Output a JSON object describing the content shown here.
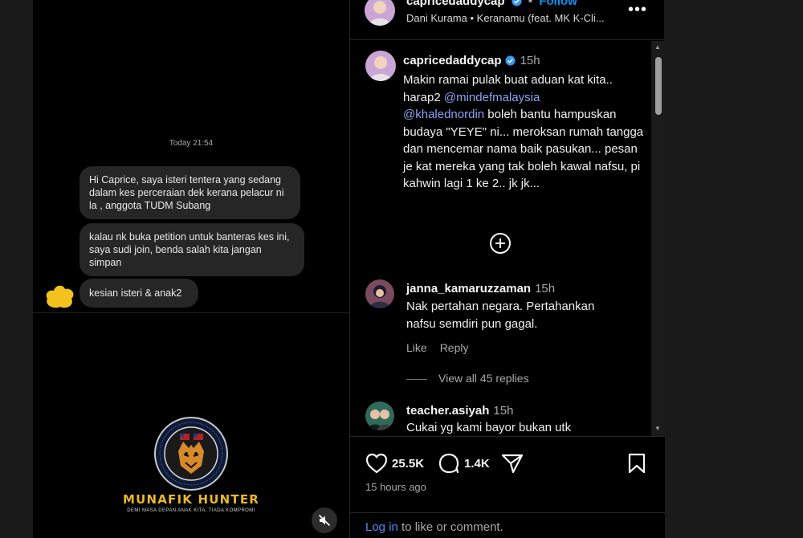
{
  "dm": {
    "timestamp": "Today 21:54",
    "messages": [
      "Hi Caprice, saya isteri tentera yang sedang dalam kes perceraian dek kerana pelacur ni la , anggota TUDM Subang",
      "kalau nk buka petition untuk banteras kes ini, saya sudi join, benda salah kita jangan simpan",
      "kesian isteri & anak2"
    ]
  },
  "brand": {
    "title": "MUNAFIK HUNTER",
    "tagline": "DEMI MASA DEPAN ANAK KITA, TIADA KOMPROMI",
    "accent_color": "#e9b82a"
  },
  "post": {
    "username": "capricedaddycap",
    "follow_label": "Follow",
    "music": "Dani Kurama • Keranamu (feat. MK K-Cli...",
    "more_icon": "more-horizontal-icon",
    "caption": {
      "username": "capricedaddycap",
      "time": "15h",
      "text_before": "Makin ramai pulak buat aduan kat kita.. harap2 ",
      "mention1": "@mindefmalaysia",
      "mention2": "@khalednordin",
      "text_after": " boleh bantu hampuskan budaya \"YEYE\" ni... meroksan rumah tangga dan mencemar nama baik pasukan... pesan je kat mereka yang tak boleh kawal nafsu, pi kahwin lagi 1 ke 2.. jk jk..."
    },
    "comments": [
      {
        "username": "janna_kamaruzzaman",
        "time": "15h",
        "text": "Nak pertahan negara. Pertahankan nafsu semdiri pun gagal.",
        "like_label": "Like",
        "reply_label": "Reply",
        "view_replies": "View all 45 replies"
      },
      {
        "username": "teacher.asiyah",
        "time": "15h",
        "text": "Cukai yg kami bayor bukan utk"
      }
    ],
    "likes": "25.5K",
    "comment_count": "1.4K",
    "posted_ago": "15 hours ago",
    "login_link": "Log in",
    "login_suffix": " to like or comment."
  }
}
